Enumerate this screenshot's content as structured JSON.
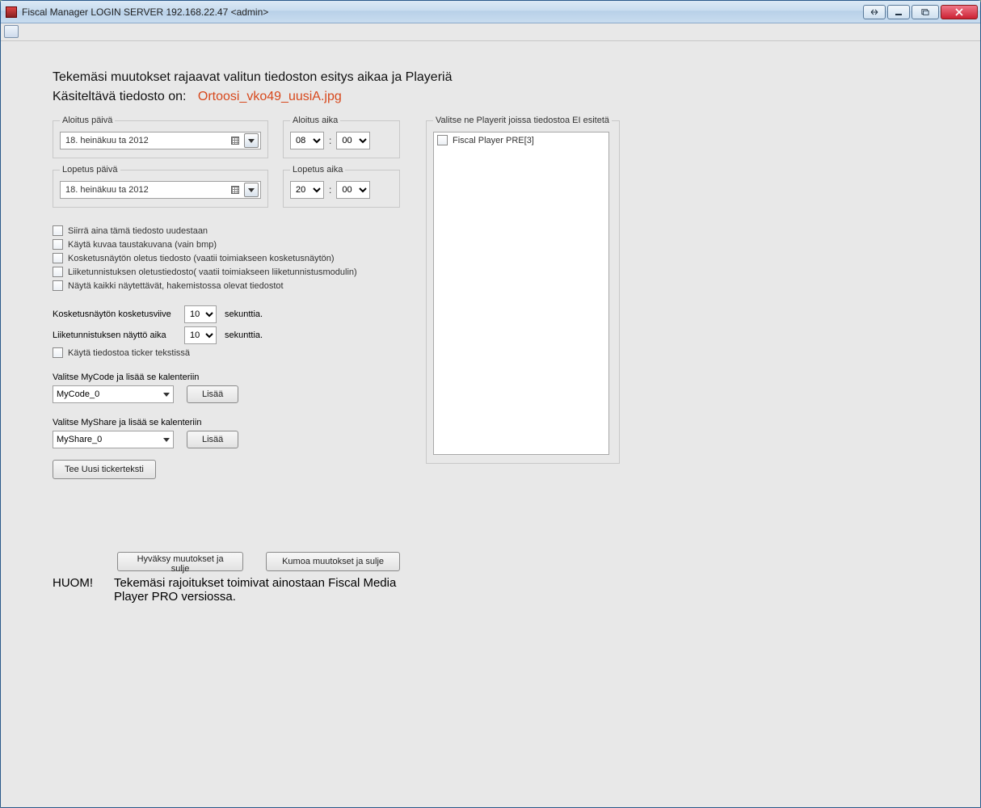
{
  "window": {
    "title": "Fiscal Manager LOGIN SERVER 192.168.22.47 <admin>"
  },
  "heading": {
    "line1": "Tekemäsi muutokset rajaavat valitun tiedoston esitys aikaa ja Playeriä",
    "line2_label": "Käsiteltävä tiedosto on:",
    "filename": "Ortoosi_vko49_uusiA.jpg"
  },
  "start": {
    "date_legend": "Aloitus päivä",
    "date_value": "18. heinäkuu ta 2012",
    "time_legend": "Aloitus aika",
    "hour": "08",
    "minute": "00"
  },
  "end": {
    "date_legend": "Lopetus päivä",
    "date_value": "18. heinäkuu ta 2012",
    "time_legend": "Lopetus aika",
    "hour": "20",
    "minute": "00"
  },
  "checks": {
    "c1": "Siirrä aina tämä tiedosto uudestaan",
    "c2": "Käytä kuvaa taustakuvana (vain bmp)",
    "c3": "Kosketusnäytön oletus tiedosto (vaatii toimiakseen kosketusnäytön)",
    "c4": "Liiketunnistuksen oletustiedosto( vaatii toimiakseen liiketunnistusmodulin)",
    "c5": "Näytä kaikki näytettävät, hakemistossa olevat tiedostot",
    "c6": "Käytä tiedostoa ticker tekstissä"
  },
  "touch": {
    "label": "Kosketusnäytön kosketusviive",
    "value": "10",
    "unit": "sekunttia."
  },
  "motion": {
    "label": "Liiketunnistuksen näyttö aika",
    "value": "10",
    "unit": "sekunttia."
  },
  "mycode": {
    "label": "Valitse MyCode ja lisää se kalenteriin",
    "value": "MyCode_0",
    "btn": "Lisää"
  },
  "myshare": {
    "label": "Valitse MyShare ja lisää se kalenteriin",
    "value": "MyShare_0",
    "btn": "Lisää"
  },
  "ticker_btn": "Tee Uusi tickerteksti",
  "players": {
    "legend": "Valitse ne Playerit joissa tiedostoa EI esitetä",
    "item1": "Fiscal Player PRE[3]"
  },
  "bottom": {
    "accept": "Hyväksy muutokset ja sulje",
    "cancel": "Kumoa muutokset ja sulje"
  },
  "note": {
    "label": "HUOM!",
    "text": "Tekemäsi rajoitukset toimivat ainostaan Fiscal Media Player PRO versiossa."
  }
}
